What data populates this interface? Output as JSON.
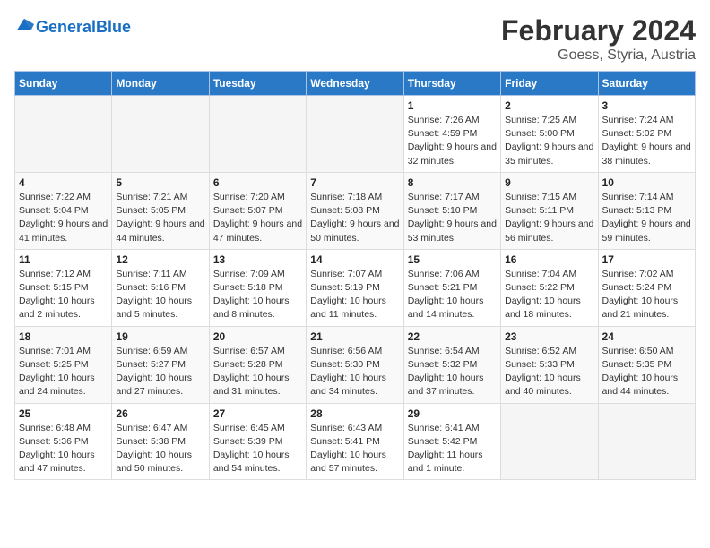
{
  "logo": {
    "text_general": "General",
    "text_blue": "Blue"
  },
  "title": "February 2024",
  "subtitle": "Goess, Styria, Austria",
  "headers": [
    "Sunday",
    "Monday",
    "Tuesday",
    "Wednesday",
    "Thursday",
    "Friday",
    "Saturday"
  ],
  "weeks": [
    [
      {
        "day": "",
        "sunrise": "",
        "sunset": "",
        "daylight": "",
        "empty": true
      },
      {
        "day": "",
        "sunrise": "",
        "sunset": "",
        "daylight": "",
        "empty": true
      },
      {
        "day": "",
        "sunrise": "",
        "sunset": "",
        "daylight": "",
        "empty": true
      },
      {
        "day": "",
        "sunrise": "",
        "sunset": "",
        "daylight": "",
        "empty": true
      },
      {
        "day": "1",
        "sunrise": "Sunrise: 7:26 AM",
        "sunset": "Sunset: 4:59 PM",
        "daylight": "Daylight: 9 hours and 32 minutes.",
        "empty": false
      },
      {
        "day": "2",
        "sunrise": "Sunrise: 7:25 AM",
        "sunset": "Sunset: 5:00 PM",
        "daylight": "Daylight: 9 hours and 35 minutes.",
        "empty": false
      },
      {
        "day": "3",
        "sunrise": "Sunrise: 7:24 AM",
        "sunset": "Sunset: 5:02 PM",
        "daylight": "Daylight: 9 hours and 38 minutes.",
        "empty": false
      }
    ],
    [
      {
        "day": "4",
        "sunrise": "Sunrise: 7:22 AM",
        "sunset": "Sunset: 5:04 PM",
        "daylight": "Daylight: 9 hours and 41 minutes.",
        "empty": false
      },
      {
        "day": "5",
        "sunrise": "Sunrise: 7:21 AM",
        "sunset": "Sunset: 5:05 PM",
        "daylight": "Daylight: 9 hours and 44 minutes.",
        "empty": false
      },
      {
        "day": "6",
        "sunrise": "Sunrise: 7:20 AM",
        "sunset": "Sunset: 5:07 PM",
        "daylight": "Daylight: 9 hours and 47 minutes.",
        "empty": false
      },
      {
        "day": "7",
        "sunrise": "Sunrise: 7:18 AM",
        "sunset": "Sunset: 5:08 PM",
        "daylight": "Daylight: 9 hours and 50 minutes.",
        "empty": false
      },
      {
        "day": "8",
        "sunrise": "Sunrise: 7:17 AM",
        "sunset": "Sunset: 5:10 PM",
        "daylight": "Daylight: 9 hours and 53 minutes.",
        "empty": false
      },
      {
        "day": "9",
        "sunrise": "Sunrise: 7:15 AM",
        "sunset": "Sunset: 5:11 PM",
        "daylight": "Daylight: 9 hours and 56 minutes.",
        "empty": false
      },
      {
        "day": "10",
        "sunrise": "Sunrise: 7:14 AM",
        "sunset": "Sunset: 5:13 PM",
        "daylight": "Daylight: 9 hours and 59 minutes.",
        "empty": false
      }
    ],
    [
      {
        "day": "11",
        "sunrise": "Sunrise: 7:12 AM",
        "sunset": "Sunset: 5:15 PM",
        "daylight": "Daylight: 10 hours and 2 minutes.",
        "empty": false
      },
      {
        "day": "12",
        "sunrise": "Sunrise: 7:11 AM",
        "sunset": "Sunset: 5:16 PM",
        "daylight": "Daylight: 10 hours and 5 minutes.",
        "empty": false
      },
      {
        "day": "13",
        "sunrise": "Sunrise: 7:09 AM",
        "sunset": "Sunset: 5:18 PM",
        "daylight": "Daylight: 10 hours and 8 minutes.",
        "empty": false
      },
      {
        "day": "14",
        "sunrise": "Sunrise: 7:07 AM",
        "sunset": "Sunset: 5:19 PM",
        "daylight": "Daylight: 10 hours and 11 minutes.",
        "empty": false
      },
      {
        "day": "15",
        "sunrise": "Sunrise: 7:06 AM",
        "sunset": "Sunset: 5:21 PM",
        "daylight": "Daylight: 10 hours and 14 minutes.",
        "empty": false
      },
      {
        "day": "16",
        "sunrise": "Sunrise: 7:04 AM",
        "sunset": "Sunset: 5:22 PM",
        "daylight": "Daylight: 10 hours and 18 minutes.",
        "empty": false
      },
      {
        "day": "17",
        "sunrise": "Sunrise: 7:02 AM",
        "sunset": "Sunset: 5:24 PM",
        "daylight": "Daylight: 10 hours and 21 minutes.",
        "empty": false
      }
    ],
    [
      {
        "day": "18",
        "sunrise": "Sunrise: 7:01 AM",
        "sunset": "Sunset: 5:25 PM",
        "daylight": "Daylight: 10 hours and 24 minutes.",
        "empty": false
      },
      {
        "day": "19",
        "sunrise": "Sunrise: 6:59 AM",
        "sunset": "Sunset: 5:27 PM",
        "daylight": "Daylight: 10 hours and 27 minutes.",
        "empty": false
      },
      {
        "day": "20",
        "sunrise": "Sunrise: 6:57 AM",
        "sunset": "Sunset: 5:28 PM",
        "daylight": "Daylight: 10 hours and 31 minutes.",
        "empty": false
      },
      {
        "day": "21",
        "sunrise": "Sunrise: 6:56 AM",
        "sunset": "Sunset: 5:30 PM",
        "daylight": "Daylight: 10 hours and 34 minutes.",
        "empty": false
      },
      {
        "day": "22",
        "sunrise": "Sunrise: 6:54 AM",
        "sunset": "Sunset: 5:32 PM",
        "daylight": "Daylight: 10 hours and 37 minutes.",
        "empty": false
      },
      {
        "day": "23",
        "sunrise": "Sunrise: 6:52 AM",
        "sunset": "Sunset: 5:33 PM",
        "daylight": "Daylight: 10 hours and 40 minutes.",
        "empty": false
      },
      {
        "day": "24",
        "sunrise": "Sunrise: 6:50 AM",
        "sunset": "Sunset: 5:35 PM",
        "daylight": "Daylight: 10 hours and 44 minutes.",
        "empty": false
      }
    ],
    [
      {
        "day": "25",
        "sunrise": "Sunrise: 6:48 AM",
        "sunset": "Sunset: 5:36 PM",
        "daylight": "Daylight: 10 hours and 47 minutes.",
        "empty": false
      },
      {
        "day": "26",
        "sunrise": "Sunrise: 6:47 AM",
        "sunset": "Sunset: 5:38 PM",
        "daylight": "Daylight: 10 hours and 50 minutes.",
        "empty": false
      },
      {
        "day": "27",
        "sunrise": "Sunrise: 6:45 AM",
        "sunset": "Sunset: 5:39 PM",
        "daylight": "Daylight: 10 hours and 54 minutes.",
        "empty": false
      },
      {
        "day": "28",
        "sunrise": "Sunrise: 6:43 AM",
        "sunset": "Sunset: 5:41 PM",
        "daylight": "Daylight: 10 hours and 57 minutes.",
        "empty": false
      },
      {
        "day": "29",
        "sunrise": "Sunrise: 6:41 AM",
        "sunset": "Sunset: 5:42 PM",
        "daylight": "Daylight: 11 hours and 1 minute.",
        "empty": false
      },
      {
        "day": "",
        "sunrise": "",
        "sunset": "",
        "daylight": "",
        "empty": true
      },
      {
        "day": "",
        "sunrise": "",
        "sunset": "",
        "daylight": "",
        "empty": true
      }
    ]
  ]
}
